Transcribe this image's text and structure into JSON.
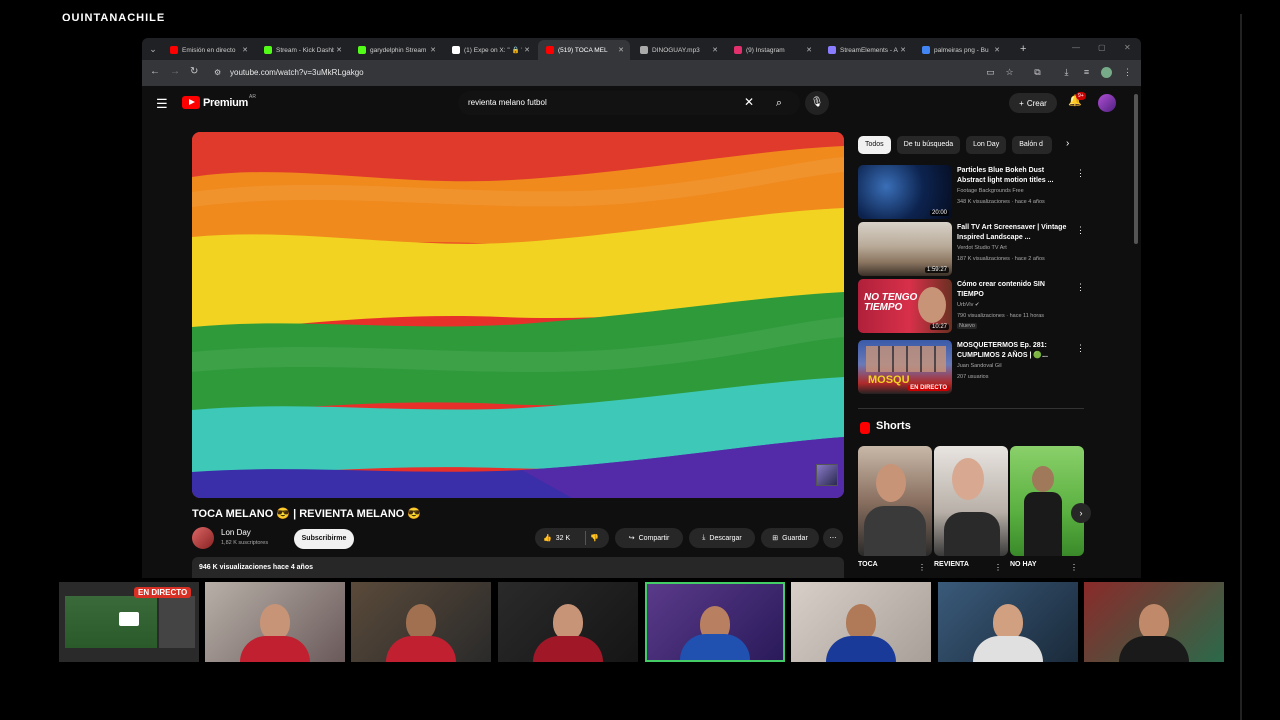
{
  "top_overlay": {
    "text": "QUINTANACHILE"
  },
  "browser": {
    "tabs": [
      {
        "label": "Emisión en directo",
        "icon": "youtube-icon",
        "color": "#ff0000"
      },
      {
        "label": "Stream - Kick Dashb",
        "icon": "kick-icon",
        "color": "#53fc18"
      },
      {
        "label": "garydelphin Stream",
        "icon": "kick-icon",
        "color": "#53fc18"
      },
      {
        "label": "(1) Expe on X: \" 🔒 \"",
        "icon": "x-icon",
        "color": "#ffffff"
      },
      {
        "label": "(519) TOCA MEL",
        "icon": "youtube-icon",
        "color": "#ff0000",
        "active": true
      },
      {
        "label": "DINOGUAY.mp3",
        "icon": "globe-icon",
        "color": "#aaaaaa"
      },
      {
        "label": "(9) Instagram",
        "icon": "instagram-icon",
        "color": "#e1306c"
      },
      {
        "label": "StreamElements - A",
        "icon": "streamelements-icon",
        "color": "#8a7cff"
      },
      {
        "label": "palmeiras png - Bu",
        "icon": "google-icon",
        "color": "#4285f4"
      }
    ],
    "url": "youtube.com/watch?v=3uMkRLgakgo"
  },
  "youtube": {
    "logo_text": "Premium",
    "logo_sup": "AR",
    "search_query": "revienta melano futbol",
    "create_label": "Crear",
    "notif_count": "9+",
    "video": {
      "title": "TOCA MELANO 😎 | REVIENTA MELANO 😎",
      "channel": "Lon Day",
      "subscribers": "1,82 K suscriptores",
      "subscribe_label": "Subscribirme",
      "likes": "32 K",
      "share_label": "Compartir",
      "download_label": "Descargar",
      "save_label": "Guardar",
      "desc": "946 K visualizaciones  hace 4 años"
    },
    "chips": [
      "Todos",
      "De tu búsqueda",
      "Lon Day",
      "Balón d"
    ],
    "recommendations": [
      {
        "title": "Particles Blue Bokeh Dust Abstract light motion titles ...",
        "channel": "Footage Backgrounds Free",
        "meta": "348 K visualizaciones · hace 4 años",
        "duration": "20:00",
        "badge": "",
        "live": ""
      },
      {
        "title": "Fall TV Art Screensaver | Vintage Inspired Landscape ...",
        "channel": "Verdot Studio TV Art",
        "meta": "187 K visualizaciones · hace 2 años",
        "duration": "1:59:27",
        "badge": "",
        "live": ""
      },
      {
        "title": "Cómo crear contenido SIN TIEMPO",
        "channel": "UrbViv ✔",
        "meta": "790 visualizaciones · hace 11 horas",
        "duration": "10:27",
        "badge": "Nuevo",
        "live": ""
      },
      {
        "title": "MOSQUETERMOS Ep. 281: CUMPLIMOS 2 AÑOS | 🟢...",
        "channel": "Juan Sandoval Gil",
        "meta": "207 usuarios",
        "duration": "",
        "badge": "",
        "live": "EN DIRECTO"
      }
    ],
    "thumb_texts": {
      "tiempo": "NO TENGO TIEMPO",
      "mosqu": "MOSQU"
    },
    "shorts_title": "Shorts",
    "shorts": [
      {
        "label": "TOCA"
      },
      {
        "label": "REVIENTA"
      },
      {
        "label": "NO HAY"
      }
    ]
  },
  "stream": {
    "live_label": "EN DIRECTO"
  },
  "colors": {
    "accent": "#ff0000",
    "cam_selected": "#44cc66",
    "background": "#0f0f0f"
  }
}
